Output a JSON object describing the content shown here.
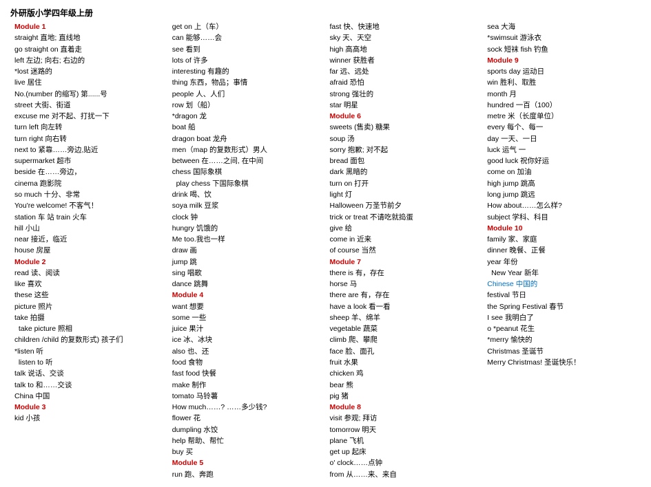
{
  "title": "外研版小学四年级上册",
  "columns": [
    {
      "id": "col1",
      "entries": [
        {
          "text": "外研版小学四年级上册",
          "class": "black bold title"
        },
        {
          "text": "Module 1",
          "class": "red"
        },
        {
          "text": "straight 直地; 直线地",
          "class": "black"
        },
        {
          "text": "go straight on 直着走",
          "class": "black"
        },
        {
          "text": "left 左边; 向右; 右边的",
          "class": "black"
        },
        {
          "text": "*lost 迷路的",
          "class": "black"
        },
        {
          "text": "live 居住",
          "class": "black"
        },
        {
          "text": "No.(number 的缩写) 第......号",
          "class": "black"
        },
        {
          "text": "street 大街、街道",
          "class": "black"
        },
        {
          "text": "excuse me 对不起、打扰一下",
          "class": "black"
        },
        {
          "text": "turn left 向左转",
          "class": "black"
        },
        {
          "text": "turn right 向右转",
          "class": "black"
        },
        {
          "text": "next to 紧靠……旁边,贴近",
          "class": "black"
        },
        {
          "text": "supermarket 超市",
          "class": "black"
        },
        {
          "text": "beside 在……旁边，",
          "class": "black"
        },
        {
          "text": "cinema 跑影院",
          "class": "black"
        },
        {
          "text": "so much 十分、非常",
          "class": "black"
        },
        {
          "text": "You're welcome! 不客气！",
          "class": "black"
        },
        {
          "text": "station 车 站 train 火车hill 小山",
          "class": "black"
        },
        {
          "text": "near 接近，临近",
          "class": "black"
        },
        {
          "text": "house 房屋",
          "class": "black"
        },
        {
          "text": "Module 2",
          "class": "red"
        },
        {
          "text": "read 读、阅读",
          "class": "black"
        },
        {
          "text": "like 喜欢",
          "class": "black"
        },
        {
          "text": "these 这些",
          "class": "black"
        },
        {
          "text": "picture 照片",
          "class": "black"
        },
        {
          "text": "take 拍摄",
          "class": "black"
        },
        {
          "text": "  take picture 照相",
          "class": "black"
        },
        {
          "text": "children /child 的复数形式) 孩子们",
          "class": "black"
        },
        {
          "text": "*listen 听",
          "class": "black"
        },
        {
          "text": "  listen to 听",
          "class": "black"
        },
        {
          "text": "talk 说话、交谈",
          "class": "black"
        },
        {
          "text": "talk to 和……交谈",
          "class": "black"
        },
        {
          "text": "China 中国",
          "class": "black"
        },
        {
          "text": "Module 3",
          "class": "red"
        },
        {
          "text": "kid 小孩",
          "class": "black"
        }
      ]
    },
    {
      "id": "col2",
      "entries": [
        {
          "text": "get on 上（车）",
          "class": "black"
        },
        {
          "text": "can 能够……会",
          "class": "black"
        },
        {
          "text": "see 看到",
          "class": "black"
        },
        {
          "text": "lots of 许多",
          "class": "black"
        },
        {
          "text": "interesting 有趣的",
          "class": "black"
        },
        {
          "text": "thing 东西，物品；事情",
          "class": "black"
        },
        {
          "text": "people 人、人们",
          "class": "black"
        },
        {
          "text": "row 划（船）",
          "class": "black"
        },
        {
          "text": "*dragon 龙",
          "class": "black"
        },
        {
          "text": "boat 船",
          "class": "black"
        },
        {
          "text": "dragon boat 龙舟",
          "class": "black"
        },
        {
          "text": "men（map 的复数形式）男人",
          "class": "black"
        },
        {
          "text": "between 在……之间, 在中间",
          "class": "black"
        },
        {
          "text": "chess 国际象棋",
          "class": "black"
        },
        {
          "text": "  play chess 下国际象棋",
          "class": "black"
        },
        {
          "text": "drink 喝、饮",
          "class": "black"
        },
        {
          "text": "soya milk 豆浆",
          "class": "black"
        },
        {
          "text": "clock 钟",
          "class": "black"
        },
        {
          "text": "hungry 饥饿的",
          "class": "black"
        },
        {
          "text": "Me too.我也一样",
          "class": "black"
        },
        {
          "text": "draw 画",
          "class": "black"
        },
        {
          "text": "jump 跳",
          "class": "black"
        },
        {
          "text": "sing 唱歌",
          "class": "black"
        },
        {
          "text": "dance 跳舞",
          "class": "black"
        },
        {
          "text": "Module 4",
          "class": "red"
        },
        {
          "text": "want 想要",
          "class": "black"
        },
        {
          "text": "some 一些",
          "class": "black"
        },
        {
          "text": "juice 果汁",
          "class": "black"
        },
        {
          "text": "ice 冰、冰块",
          "class": "black"
        },
        {
          "text": "also 也、还",
          "class": "black"
        },
        {
          "text": "food 食物",
          "class": "black"
        },
        {
          "text": "fast food 快餐",
          "class": "black"
        },
        {
          "text": "make 制作",
          "class": "black"
        },
        {
          "text": "tomato 马铃薯",
          "class": "black"
        },
        {
          "text": "How much……? ……多少钱?",
          "class": "black"
        },
        {
          "text": "flower 花",
          "class": "black"
        },
        {
          "text": "dumpling 水饺",
          "class": "black"
        },
        {
          "text": "help 帮助、帮忙",
          "class": "black"
        },
        {
          "text": "buy 买",
          "class": "black"
        },
        {
          "text": "Module 5",
          "class": "red"
        },
        {
          "text": "run 跑、奔跑",
          "class": "black"
        }
      ]
    },
    {
      "id": "col3",
      "entries": [
        {
          "text": "fast 快、快速地",
          "class": "black"
        },
        {
          "text": "sky 天、天空",
          "class": "black"
        },
        {
          "text": "high 高高地",
          "class": "black"
        },
        {
          "text": "winner 获胜者",
          "class": "black"
        },
        {
          "text": "far 远、远处",
          "class": "black"
        },
        {
          "text": "afraid 恐怕",
          "class": "black"
        },
        {
          "text": "strong 强壮的",
          "class": "black"
        },
        {
          "text": "star 明星",
          "class": "black"
        },
        {
          "text": "Module 6",
          "class": "red"
        },
        {
          "text": "sweets (售卖) 糖果",
          "class": "black"
        },
        {
          "text": "soup 汤",
          "class": "black"
        },
        {
          "text": "sorry 抱歉; 对不起",
          "class": "black"
        },
        {
          "text": "bread 面包",
          "class": "black"
        },
        {
          "text": "dark 黑暗的",
          "class": "black"
        },
        {
          "text": "turn on 打开",
          "class": "black"
        },
        {
          "text": "light 灯",
          "class": "black"
        },
        {
          "text": "Halloween 万圣节前夕",
          "class": "black"
        },
        {
          "text": "trick or treat 不请吃就捣蛋",
          "class": "black"
        },
        {
          "text": "give 给",
          "class": "black"
        },
        {
          "text": "come in 近来",
          "class": "black"
        },
        {
          "text": "of course 当然",
          "class": "black"
        },
        {
          "text": "Module 7",
          "class": "red"
        },
        {
          "text": "there is 有，存在",
          "class": "black"
        },
        {
          "text": "horse 马",
          "class": "black"
        },
        {
          "text": "there are 有，存在",
          "class": "black"
        },
        {
          "text": "have a look 看一看",
          "class": "black"
        },
        {
          "text": "sheep 羊、绵羊",
          "class": "black"
        },
        {
          "text": "vegetable 蔬菜",
          "class": "black"
        },
        {
          "text": "climb 爬、攀爬",
          "class": "black"
        },
        {
          "text": "face 脸、面孔",
          "class": "black"
        },
        {
          "text": "fruit 水果",
          "class": "black"
        },
        {
          "text": "chicken 鸡",
          "class": "black"
        },
        {
          "text": "bear 熊",
          "class": "black"
        },
        {
          "text": "pig 猪",
          "class": "black"
        },
        {
          "text": "Module 8",
          "class": "red"
        },
        {
          "text": "visit 参观; 拜访",
          "class": "black"
        },
        {
          "text": "tomorrow 明天",
          "class": "black"
        },
        {
          "text": "plane 飞机",
          "class": "black"
        },
        {
          "text": "get up 起床",
          "class": "black"
        },
        {
          "text": "o' clock……点钟",
          "class": "black"
        },
        {
          "text": "from 从……来、来自",
          "class": "black"
        }
      ]
    },
    {
      "id": "col4",
      "entries": [
        {
          "text": "sea 大海",
          "class": "black"
        },
        {
          "text": "*swimsuit 游泳衣",
          "class": "black"
        },
        {
          "text": "sock 短袜 fish 钓鱼",
          "class": "black"
        },
        {
          "text": "Module 9",
          "class": "red"
        },
        {
          "text": "sports day 运动日",
          "class": "black"
        },
        {
          "text": "win 胜利、取胜",
          "class": "black"
        },
        {
          "text": "month 月",
          "class": "black"
        },
        {
          "text": "hundred 一百（100）",
          "class": "black"
        },
        {
          "text": "metre 米（长度单位）",
          "class": "black"
        },
        {
          "text": "every 每个、每一",
          "class": "black"
        },
        {
          "text": "day 一天、一日",
          "class": "black"
        },
        {
          "text": "luck 运气 一",
          "class": "black"
        },
        {
          "text": "good luck 祝你好运",
          "class": "black"
        },
        {
          "text": "come on 加油",
          "class": "black"
        },
        {
          "text": "high jump 跳高",
          "class": "black"
        },
        {
          "text": "long jump 跳远",
          "class": "black"
        },
        {
          "text": "How about……怎么样?",
          "class": "black"
        },
        {
          "text": "subject 学科、科目",
          "class": "black"
        },
        {
          "text": "Module 10",
          "class": "red"
        },
        {
          "text": "family 家、家庭",
          "class": "black"
        },
        {
          "text": "dinner 晚餐、正餐",
          "class": "black"
        },
        {
          "text": "year 年份",
          "class": "black"
        },
        {
          "text": "  New Year 新年",
          "class": "black"
        },
        {
          "text": "Chinese 中国的",
          "class": "blue"
        },
        {
          "text": "festival 节日",
          "class": "black"
        },
        {
          "text": "the Spring Festival 春节",
          "class": "black"
        },
        {
          "text": "I see 我明白了",
          "class": "black"
        },
        {
          "text": "o *peanut 花生",
          "class": "black"
        },
        {
          "text": "*merry 愉快的",
          "class": "black"
        },
        {
          "text": "Christmas 圣诞节",
          "class": "black"
        },
        {
          "text": "Merry Christmas! 圣诞快乐！",
          "class": "black"
        }
      ]
    }
  ]
}
